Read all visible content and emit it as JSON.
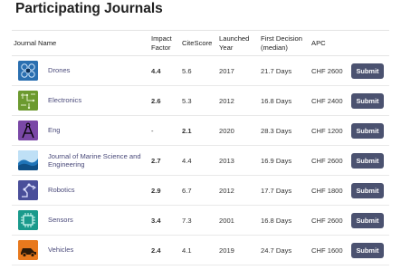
{
  "page": {
    "title": "Participating Journals"
  },
  "table": {
    "headers": {
      "journal_name": "Journal Name",
      "impact_factor_line1": "Impact",
      "impact_factor_line2": "Factor",
      "citescore": "CiteScore",
      "launched_line1": "Launched",
      "launched_line2": "Year",
      "first_decision_line1": "First Decision",
      "first_decision_line2": "(median)",
      "apc": "APC"
    },
    "rows": [
      {
        "name": "Drones",
        "impact_factor": "4.4",
        "citescore": "5.6",
        "year": "2017",
        "first_decision": "21.7 Days",
        "apc": "CHF 2600",
        "button": "Submit",
        "logo": "drones-logo",
        "logo_color": "#2a6fb0"
      },
      {
        "name": "Electronics",
        "impact_factor": "2.6",
        "citescore": "5.3",
        "year": "2012",
        "first_decision": "16.8 Days",
        "apc": "CHF 2400",
        "button": "Submit",
        "logo": "electronics-logo",
        "logo_color": "#6c9a2f"
      },
      {
        "name": "Eng",
        "impact_factor": "-",
        "citescore": "2.1",
        "year": "2020",
        "first_decision": "28.3 Days",
        "apc": "CHF 1200",
        "button": "Submit",
        "logo": "eng-logo",
        "logo_color": "#7a48a6"
      },
      {
        "name_line1": "Journal of Marine Science and",
        "name_line2": "Engineering",
        "impact_factor": "2.7",
        "citescore": "4.4",
        "year": "2013",
        "first_decision": "16.9 Days",
        "apc": "CHF 2600",
        "button": "Submit",
        "logo": "marine-logo",
        "logo_color": "#2c7fc0"
      },
      {
        "name": "Robotics",
        "impact_factor": "2.9",
        "citescore": "6.7",
        "year": "2012",
        "first_decision": "17.7 Days",
        "apc": "CHF 1800",
        "button": "Submit",
        "logo": "robotics-logo",
        "logo_color": "#4a4f9a"
      },
      {
        "name": "Sensors",
        "impact_factor": "3.4",
        "citescore": "7.3",
        "year": "2001",
        "first_decision": "16.8 Days",
        "apc": "CHF 2600",
        "button": "Submit",
        "logo": "sensors-logo",
        "logo_color": "#1a9a8c"
      },
      {
        "name": "Vehicles",
        "impact_factor": "2.4",
        "citescore": "4.1",
        "year": "2019",
        "first_decision": "24.7 Days",
        "apc": "CHF 1600",
        "button": "Submit",
        "logo": "vehicles-logo",
        "logo_color": "#e8791d"
      }
    ]
  },
  "colors": {
    "button_bg": "#4b5270",
    "journal_link": "#4a4a7a"
  }
}
